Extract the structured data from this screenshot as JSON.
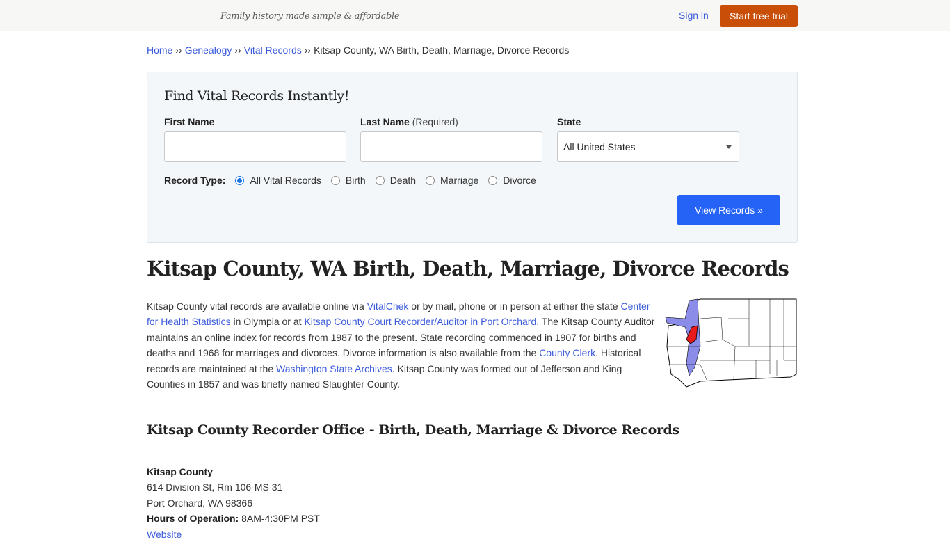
{
  "header": {
    "tagline": "Family history made simple & affordable",
    "sign_in": "Sign in",
    "start_trial": "Start free trial",
    "accent_color": "#c94f09"
  },
  "breadcrumb": {
    "items": [
      "Home",
      "Genealogy",
      "Vital Records"
    ],
    "separator": "››",
    "current": "Kitsap County, WA Birth, Death, Marriage, Divorce Records"
  },
  "search": {
    "title": "Find Vital Records Instantly!",
    "first_name_label": "First Name",
    "first_name_value": "",
    "last_name_label": "Last Name",
    "last_name_note": "(Required)",
    "last_name_value": "",
    "state_label": "State",
    "state_value": "All United States",
    "record_type_label": "Record Type:",
    "record_types": [
      {
        "label": "All Vital Records",
        "checked": true
      },
      {
        "label": "Birth",
        "checked": false
      },
      {
        "label": "Death",
        "checked": false
      },
      {
        "label": "Marriage",
        "checked": false
      },
      {
        "label": "Divorce",
        "checked": false
      }
    ],
    "submit": "View Records »",
    "submit_color": "#2463f5"
  },
  "page": {
    "title": "Kitsap County, WA Birth, Death, Marriage, Divorce Records",
    "intro": {
      "t1": "Kitsap County vital records are available online via ",
      "link1": "VitalChek",
      "t2": " or by mail, phone or in person at either the state ",
      "link2": "Center for Health Statistics",
      "t3": " in Olympia or at ",
      "link3": "Kitsap County Court Recorder/Auditor in Port Orchard",
      "t4": ". The Kitsap County Auditor maintains an online index for records from 1987 to the present. State recording commenced in 1907 for births and deaths and 1968 for marriages and divorces. Divorce information is also available from the ",
      "link4": "County Clerk",
      "t5": ". Historical records are maintained at the ",
      "link5": "Washington State Archives",
      "t6": ". Kitsap County was formed out of Jefferson and King Counties in 1857 and was briefly named Slaughter County."
    },
    "map_alt": "Washington state map highlighting Kitsap County",
    "section_title": "Kitsap County Recorder Office - Birth, Death, Marriage & Divorce Records",
    "office": {
      "name": "Kitsap County",
      "address1": "614 Division St, Rm 106-MS 31",
      "address2": "Port Orchard, WA 98366",
      "hours_label": "Hours of Operation:",
      "hours": "8AM-4:30PM PST",
      "website": "Website"
    }
  }
}
